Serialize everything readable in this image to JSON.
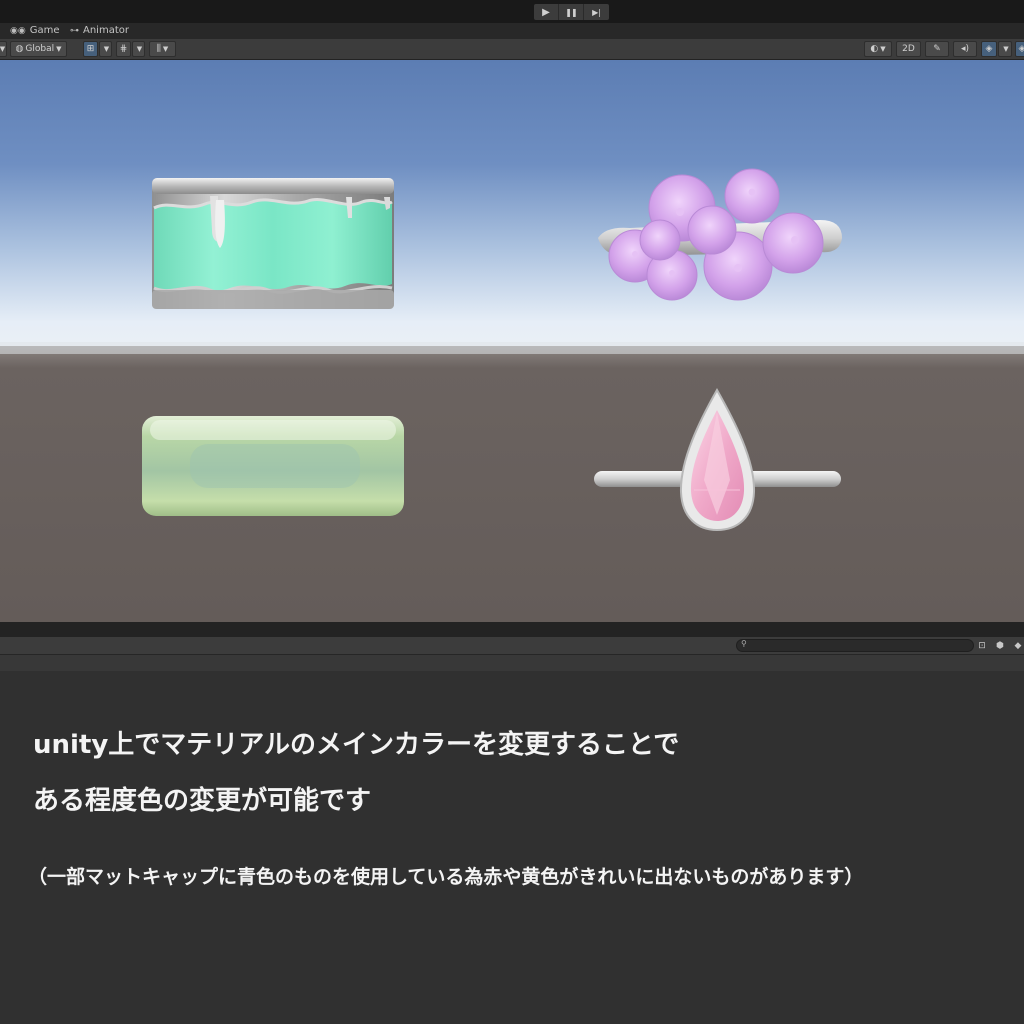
{
  "playbar": {
    "buttons": [
      {
        "name": "play-icon",
        "glyph": "▶"
      },
      {
        "name": "pause-icon",
        "glyph": "❚❚"
      },
      {
        "name": "step-icon",
        "glyph": "▶|"
      }
    ]
  },
  "tabs": [
    {
      "label": "Game",
      "icon": "gamepad-icon",
      "glyph": "👾"
    },
    {
      "label": "Animator",
      "icon": "animator-icon",
      "glyph": "⊶"
    }
  ],
  "toolbar": {
    "pivot_space_label": "Global",
    "shading_mode_2d_label": "2D"
  },
  "caption": {
    "line1": "unity上でマテリアルのメインカラーを変更することで",
    "line2": "ある程度色の変更が可能です",
    "note": "（一部マットキャップに青色のものを使用している為赤や黄色がきれいに出ないものがあります）"
  },
  "colors": {
    "sky_top": "#5d7fb4",
    "horizon": "#e3ebf4",
    "ground": "#675f5c",
    "mint_band": "#7fe8c8",
    "lavender_flowers": "#d5a7ea",
    "pink_gem": "#f4b8d3",
    "green_band": "#c8e2b4"
  }
}
